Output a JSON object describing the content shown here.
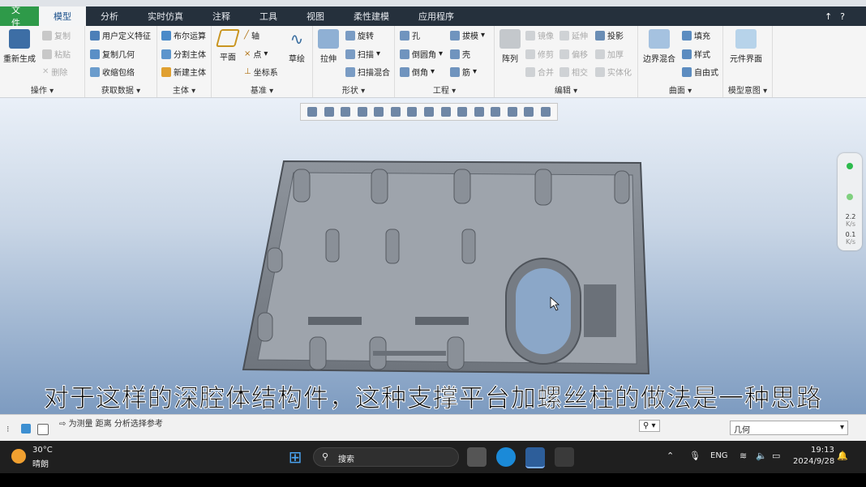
{
  "tabs": [
    "文件",
    "模型",
    "分析",
    "实时仿真",
    "注释",
    "工具",
    "视图",
    "柔性建模",
    "应用程序"
  ],
  "groups": {
    "operations": {
      "title": "操作",
      "regen": "重新生成",
      "copy": "复制",
      "paste": "粘贴",
      "delete": "删除"
    },
    "getdata": {
      "title": "获取数据",
      "udf": "用户定义特征",
      "copygeom": "复制几何",
      "shrinkwrap": "收缩包络"
    },
    "body": {
      "title": "主体",
      "boolean": "布尔运算",
      "split": "分割主体",
      "newbody": "新建主体"
    },
    "datum": {
      "title": "基准",
      "plane": "平面",
      "axis": "轴",
      "point": "点",
      "csys": "坐标系",
      "sketch": "草绘"
    },
    "shapes": {
      "title": "形状",
      "extrude": "拉伸",
      "revolve": "旋转",
      "sweep": "扫描",
      "sweepblend": "扫描混合"
    },
    "engineering": {
      "title": "工程",
      "hole": "孔",
      "round": "倒圆角",
      "chamfer": "倒角",
      "draft": "拔模",
      "shell": "壳",
      "rib": "筋"
    },
    "editing": {
      "title": "编辑",
      "pattern": "阵列",
      "mirror": "镜像",
      "trim": "修剪",
      "merge": "合并",
      "extend": "延伸",
      "offset": "偏移",
      "intersect": "相交",
      "project": "投影",
      "thicken": "加厚",
      "solidify": "实体化"
    },
    "surfaces": {
      "title": "曲面",
      "boundary": "边界混合",
      "fill": "填充",
      "style": "样式",
      "freestyle": "自由式"
    },
    "modelintent": {
      "title": "模型意图",
      "component": "元件界面"
    }
  },
  "rightpanel": {
    "v1": "2.2",
    "u1": "K/s",
    "v2": "0.1",
    "u2": "K/s"
  },
  "subtitle": "对于这样的深腔体结构件，这种支撑平台加螺丝柱的做法是一种思路",
  "status": {
    "message": "为测量 距离 分析选择参考",
    "filter": "几何"
  },
  "taskbar": {
    "temp": "30°C",
    "weather": "晴朗",
    "search": "搜索",
    "lang": "ENG",
    "time": "19:13",
    "date": "2024/9/28"
  }
}
